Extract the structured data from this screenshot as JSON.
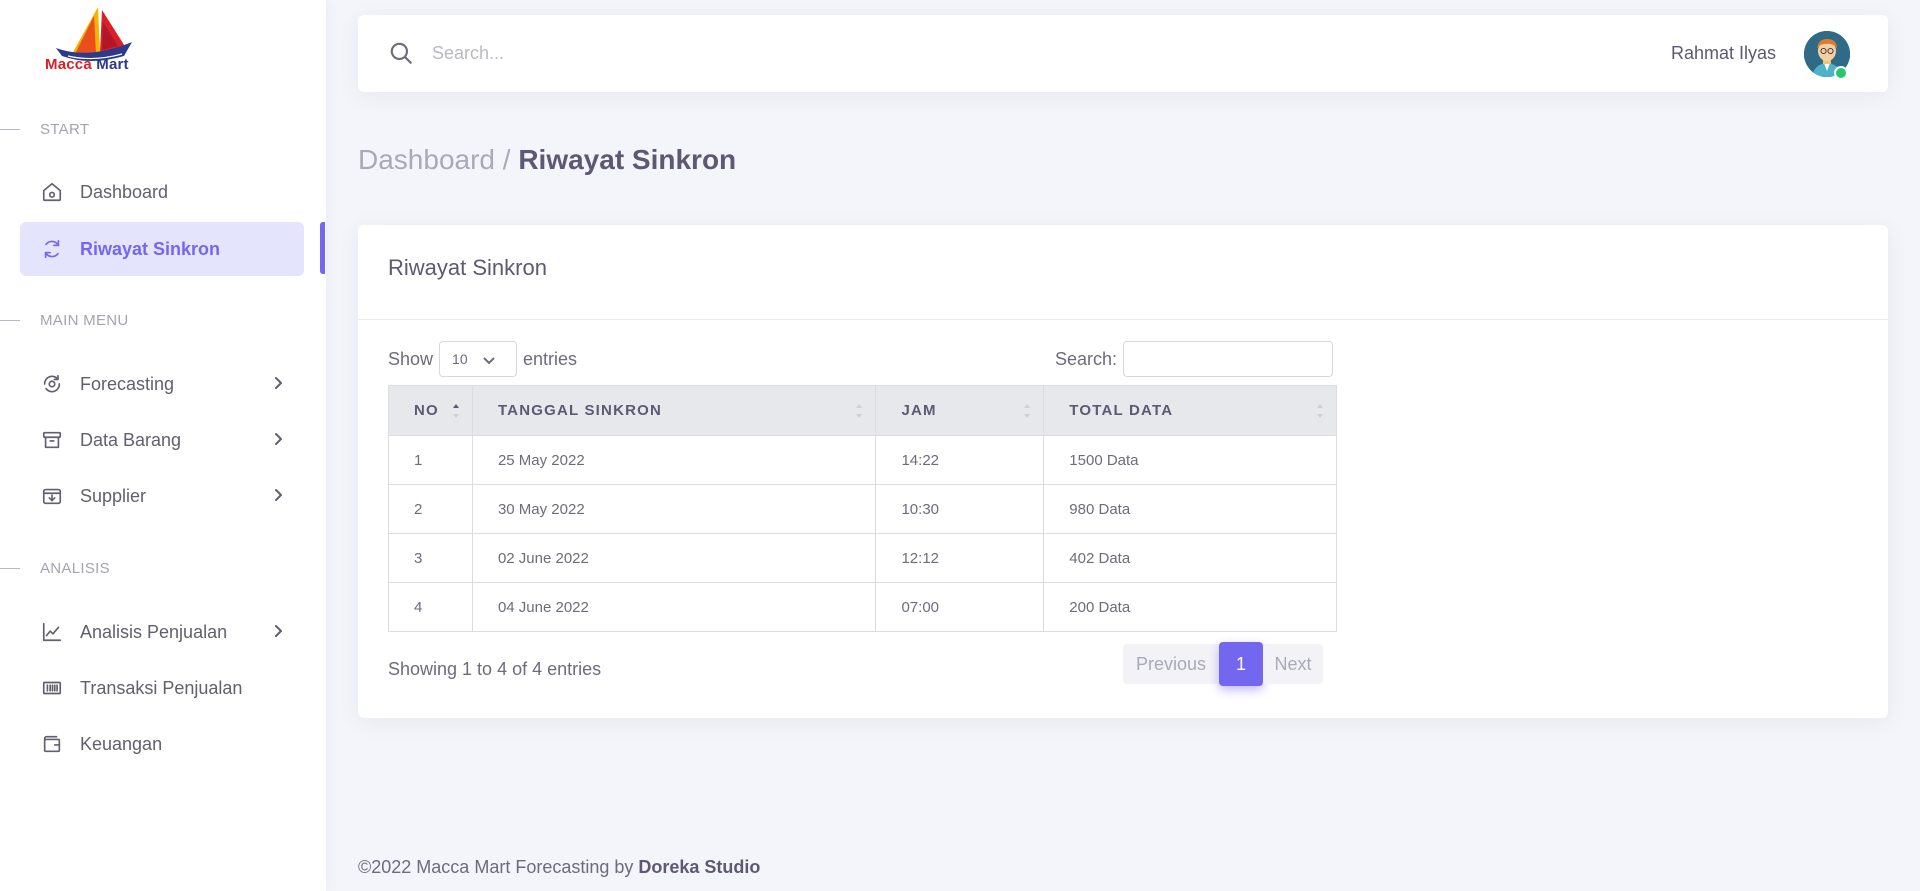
{
  "brand": {
    "word1": "Macca",
    "word2": "Mart"
  },
  "sidebar": {
    "sections": [
      {
        "label": "START"
      },
      {
        "label": "MAIN MENU"
      },
      {
        "label": "ANALISIS"
      }
    ],
    "items": [
      {
        "label": "Dashboard",
        "icon": "home-icon"
      },
      {
        "label": "Riwayat Sinkron",
        "icon": "sync-icon",
        "active": true
      },
      {
        "label": "Forecasting",
        "icon": "forecast-icon"
      },
      {
        "label": "Data Barang",
        "icon": "archive-icon"
      },
      {
        "label": "Supplier",
        "icon": "box-download-icon"
      },
      {
        "label": "Analisis Penjualan",
        "icon": "line-chart-icon"
      },
      {
        "label": "Transaksi Penjualan",
        "icon": "barcode-icon"
      },
      {
        "label": "Keuangan",
        "icon": "wallet-icon"
      }
    ]
  },
  "topbar": {
    "search_placeholder": "Search...",
    "user_name": "Rahmat Ilyas"
  },
  "breadcrumb": {
    "parent": "Dashboard",
    "separator": "/",
    "current": "Riwayat Sinkron"
  },
  "card": {
    "title": "Riwayat Sinkron",
    "show_label": "Show",
    "entries_label": "entries",
    "page_length": "10",
    "search_label": "Search:",
    "columns": [
      "NO",
      "TANGGAL SINKRON",
      "JAM",
      "TOTAL DATA"
    ],
    "rows": [
      [
        "1",
        "25 May 2022",
        "14:22",
        "1500 Data"
      ],
      [
        "2",
        "30 May 2022",
        "10:30",
        "980 Data"
      ],
      [
        "3",
        "02 June 2022",
        "12:12",
        "402 Data"
      ],
      [
        "4",
        "04 June 2022",
        "07:00",
        "200 Data"
      ]
    ],
    "info": "Showing 1 to 4 of 4 entries",
    "pagination": {
      "previous": "Previous",
      "current": "1",
      "next": "Next"
    }
  },
  "footer": {
    "text": "©2022 Macca Mart Forecasting by ",
    "brand": "Doreka Studio"
  },
  "colors": {
    "accent": "#7367f0",
    "accent_light": "#e5e4fd",
    "online": "#28c76f"
  }
}
